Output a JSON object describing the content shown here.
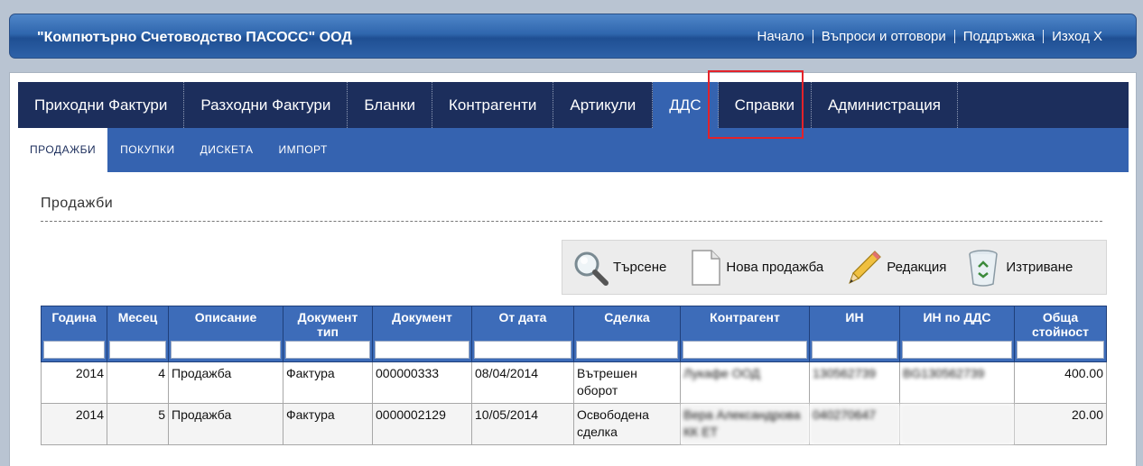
{
  "header": {
    "company": "\"Компютърно Счетоводство ПАСОСС\" ООД",
    "links": [
      "Начало",
      "Въпроси и отговори",
      "Поддръжка",
      "Изход X"
    ]
  },
  "main_nav": {
    "items": [
      "Приходни Фактури",
      "Разходни Фактури",
      "Бланки",
      "Контрагенти",
      "Артикули",
      "ДДС",
      "Справки",
      "Администрация"
    ],
    "active": "ДДС"
  },
  "sub_nav": {
    "items": [
      "ПРОДАЖБИ",
      "ПОКУПКИ",
      "ДИСКЕТА",
      "ИМПОРТ"
    ],
    "active": "ПРОДАЖБИ"
  },
  "page": {
    "title": "Продажби"
  },
  "toolbar": {
    "search": "Търсене",
    "new_sale": "Нова продажба",
    "edit": "Редакция",
    "delete": "Изтриване"
  },
  "table": {
    "columns": [
      "Година",
      "Месец",
      "Описание",
      "Документ тип",
      "Документ",
      "От дата",
      "Сделка",
      "Контрагент",
      "ИН",
      "ИН по ДДС",
      "Обща стойност"
    ],
    "rows": [
      [
        "2014",
        "4",
        "Продажба",
        "Фактура",
        "000000333",
        "08/04/2014",
        "Вътрешен оборот",
        "Лукафе ООД",
        "130562739",
        "BG130562739",
        "400.00"
      ],
      [
        "2014",
        "5",
        "Продажба",
        "Фактура",
        "0000002129",
        "10/05/2014",
        "Освободена сделка",
        "Вера Александрова КК ЕТ",
        "040270647",
        "",
        "20.00"
      ]
    ]
  }
}
